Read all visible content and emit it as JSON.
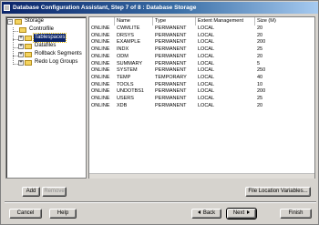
{
  "window": {
    "title": "Database Configuration Assistant, Step 7 of 8 : Database Storage"
  },
  "tree": {
    "items": [
      {
        "label": "Storage"
      },
      {
        "label": "Controlfile"
      },
      {
        "label": "Tablespaces"
      },
      {
        "label": "Datafiles"
      },
      {
        "label": "Rollback Segments"
      },
      {
        "label": "Redo Log Groups"
      }
    ]
  },
  "table": {
    "columns": [
      "",
      "Name",
      "Type",
      "Extent Management",
      "Size (M)"
    ],
    "rows": [
      {
        "status": "ONLINE",
        "name": "CWMLITE",
        "type": "PERMANENT",
        "extent": "LOCAL",
        "size": "20"
      },
      {
        "status": "ONLINE",
        "name": "DRSYS",
        "type": "PERMANENT",
        "extent": "LOCAL",
        "size": "20"
      },
      {
        "status": "ONLINE",
        "name": "EXAMPLE",
        "type": "PERMANENT",
        "extent": "LOCAL",
        "size": "200"
      },
      {
        "status": "ONLINE",
        "name": "INDX",
        "type": "PERMANENT",
        "extent": "LOCAL",
        "size": "25"
      },
      {
        "status": "ONLINE",
        "name": "ODM",
        "type": "PERMANENT",
        "extent": "LOCAL",
        "size": "20"
      },
      {
        "status": "ONLINE",
        "name": "SUMMARY",
        "type": "PERMANENT",
        "extent": "LOCAL",
        "size": "5"
      },
      {
        "status": "ONLINE",
        "name": "SYSTEM",
        "type": "PERMANENT",
        "extent": "LOCAL",
        "size": "250"
      },
      {
        "status": "ONLINE",
        "name": "TEMP",
        "type": "TEMPORARY",
        "extent": "LOCAL",
        "size": "40"
      },
      {
        "status": "ONLINE",
        "name": "TOOLS",
        "type": "PERMANENT",
        "extent": "LOCAL",
        "size": "10"
      },
      {
        "status": "ONLINE",
        "name": "UNDOTBS1",
        "type": "PERMANENT",
        "extent": "LOCAL",
        "size": "200"
      },
      {
        "status": "ONLINE",
        "name": "USERS",
        "type": "PERMANENT",
        "extent": "LOCAL",
        "size": "25"
      },
      {
        "status": "ONLINE",
        "name": "XDB",
        "type": "PERMANENT",
        "extent": "LOCAL",
        "size": "20"
      }
    ]
  },
  "buttons": {
    "add": "Add",
    "remove": "Remove",
    "file_location": "File Location Variables...",
    "cancel": "Cancel",
    "help": "Help",
    "back": "Back",
    "next": "Next",
    "finish": "Finish"
  },
  "colors": {
    "selection": "#0a246a",
    "titlebar": "#0a246a",
    "window_bg": "#d6d3ce"
  }
}
